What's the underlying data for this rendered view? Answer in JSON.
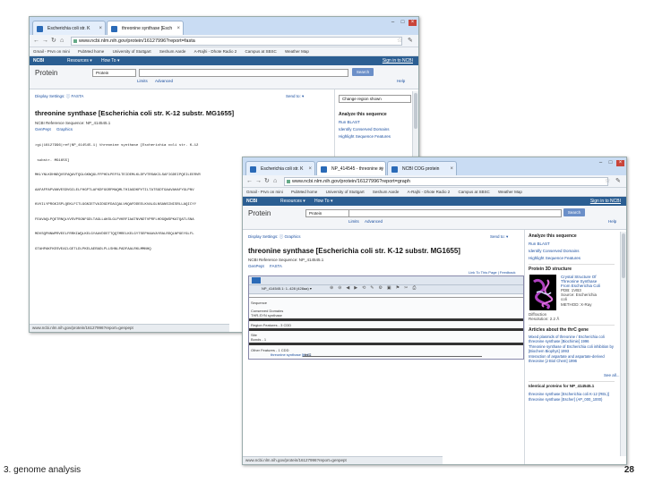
{
  "slide": {
    "caption": "3. genome analysis",
    "page_number": "28"
  },
  "screenshot_back": {
    "tabs": [
      {
        "label": "Escherichia coli str. K",
        "active": false
      },
      {
        "label": "threonine synthase [Esch",
        "active": true
      }
    ],
    "url": "www.ncbi.nlm.nih.gov/protein/16127996?report=fasta",
    "bookmarks": [
      "Gmail - Prvn on mini",
      "PubMed home",
      "University of Stuttgart",
      "Seshum Aarde",
      "A-Rajhi - Dhote Radio 2",
      "Campus at SBSC",
      "Weather Map"
    ],
    "ncbi_bar": {
      "logo": "NCBI",
      "resources": "Resources ▾",
      "howto": "How To ▾",
      "signin": "Sign in to NCBI"
    },
    "search": {
      "db_title": "Protein",
      "db_select": "Protein",
      "button": "Search",
      "limits": "Limits",
      "advanced": "Advanced",
      "help": "Help"
    },
    "display_settings": "Display Settings: ⓘ FASTA",
    "send_to": "Send to: ▾",
    "title": "threonine synthase [Escherichia coli str. K-12 substr. MG1655]",
    "refseq": "NCBI Reference Sequence: NP_414545.1",
    "genpept": "GenPept",
    "graphics": "Graphics",
    "fasta_lines": [
      ">gi|16127996|ref|NP_414545.1| threonine synthase [Escherichia coli str. K-12",
      " substr. MG1655]",
      "MKLYNLKDHNEQVSFAQAVTQGLGKNQGLFFPHDLPEFSLTEIDEMLKLDFVTRSAKILSAFIGDEIPQEILEERVR",
      "AAFAFPAPVANVESDVGCLELFHGPTLAFKDFGGRFMAQMLTHIAGDKPVTILTATSGDTGAAVAHAFYGLPNV",
      "KVVILYPRGKISPLQEKLFCTLGGNIETVAIDGDFDACQALVKQAFDDEELKVALGLNSANSINISRLLAQICYY",
      "FEAVAQLPQETRNQLVVSVPSGNFGDLTAGLLAKSLGLPVKRFIAATNVNDTVPRFLHDGQWSPKATQATLSNA",
      "MDVSQPNNWPRVEELFRRKIWQLKELGYAAVDDETTQQTMRELKELGYTSEPHAAVAYRALRDQLNPGEYGLFL",
      "GTAHPAKFKESVEAILGETLDLPKELAERADLPLLSHNLPADFAALRKLMMNHQ"
    ],
    "right_panel": {
      "change_region": "Change region shown",
      "analyze_title": "Analyze this sequence",
      "links": [
        "Run BLAST",
        "Identify Conserved Domains",
        "Highlight Sequence Features"
      ]
    },
    "status": "www.ncbi.nlm.nih.gov/protein/16127996?report=genpept"
  },
  "screenshot_front": {
    "tabs": [
      {
        "label": "Escherichia coli str. K",
        "active": false
      },
      {
        "label": "NP_414545 - threonine sy",
        "active": true
      },
      {
        "label": "NCBI COG protein",
        "active": false
      }
    ],
    "url": "www.ncbi.nlm.nih.gov/protein/16127996?report=graph",
    "bookmarks": [
      "Gmail - Prvn on mini",
      "PubMed home",
      "University of Stuttgart",
      "Seshum Aarde",
      "A-Rajhi - Dhote Radio 2",
      "Campus at SBSC",
      "Weather Map"
    ],
    "ncbi_bar": {
      "logo": "NCBI",
      "resources": "Resources ▾",
      "howto": "How To ▾",
      "signin": "Sign in to NCBI"
    },
    "search": {
      "db_title": "Protein",
      "db_select": "Protein",
      "button": "Search",
      "limits": "Limits",
      "advanced": "Advanced",
      "help": "Help"
    },
    "display_settings": "Display Settings: ⓘ Graphics",
    "send_to": "Send to: ▾",
    "title": "threonine synthase [Escherichia coli str. K-12 substr. MG1655]",
    "refseq": "NCBI Reference Sequence: NP_414545.1",
    "genpept": "GenPept",
    "fasta": "FASTA",
    "tooltip_link": "Link To This Page | Feedback",
    "viewer": {
      "seq_label": "NP_414545.1: 1..428 (428aa) ▾",
      "tracks": [
        "Sequence",
        "Conserved Domains",
        "THR-SYN synthase",
        "Region Features - 3 CDD",
        "Site",
        "Bonds - 1",
        "Other Features - 1 CDD"
      ],
      "feature_label": "threonine synthase [thrC]",
      "feature_tag": "thrC"
    },
    "right_panel": {
      "analyze_title": "Analyze this sequence",
      "links": [
        "Run BLAST",
        "Identify Conserved Domains",
        "Highlight Sequence Features"
      ],
      "structure_title": "Protein 3D structure",
      "structure_text": [
        "Crystal Structure Of",
        "Threonine Synthase",
        "From Escherichia Coli",
        "PDB: 1VB3",
        "Source: Escherichia",
        "coli",
        "METHOD: X-Ray",
        "Diffraction",
        "Resolution: 2.2 Å"
      ],
      "articles_title": "Articles about the thrC gene",
      "articles": [
        "Mixed plasmids of threonine / Escherichia coli threonine synthase [Biochimie] 1996",
        "Threonine synthase of Escherichia coli inhibition by [Biochem Biophys] 1993",
        "Interaction of aspartate and aspartate-derived threonine [J Biol Chem] 1996"
      ],
      "see_all": "See all...",
      "identical_title": "Identical proteins for NP_414545.1",
      "identical": [
        "threonine synthase [Escherichia coli K-12 (REL)]",
        "threonine synthase [Escher] (AP_000_1000)"
      ]
    },
    "status": "www.ncbi.nlm.nih.gov/protein/16127996?report=genpept"
  }
}
